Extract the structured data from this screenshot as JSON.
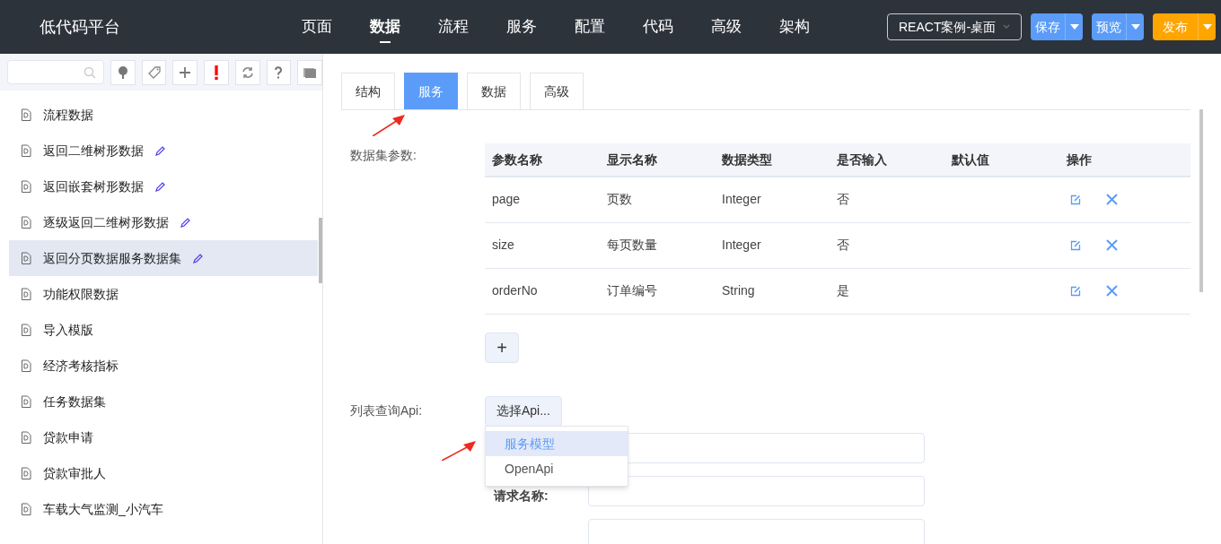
{
  "app_title": "低代码平台",
  "nav": [
    {
      "label": "页面",
      "selected": false
    },
    {
      "label": "数据",
      "selected": true
    },
    {
      "label": "流程",
      "selected": false
    },
    {
      "label": "服务",
      "selected": false
    },
    {
      "label": "配置",
      "selected": false
    },
    {
      "label": "代码",
      "selected": false
    },
    {
      "label": "高级",
      "selected": false
    },
    {
      "label": "架构",
      "selected": false
    }
  ],
  "project_select": {
    "value": "REACT案例-桌面"
  },
  "actions": [
    {
      "label": "保存",
      "kind": "blue"
    },
    {
      "label": "预览",
      "kind": "blue"
    },
    {
      "label": "发布",
      "kind": "orange"
    }
  ],
  "toolbar_icons": [
    {
      "kind": "tree"
    },
    {
      "kind": "tag"
    },
    {
      "kind": "plus"
    },
    {
      "kind": "alert"
    },
    {
      "kind": "refresh"
    },
    {
      "kind": "help"
    },
    {
      "kind": "layers"
    }
  ],
  "sidebar_items": [
    {
      "label": "流程数据",
      "selected": false,
      "editable": false
    },
    {
      "label": "返回二维树形数据",
      "selected": false,
      "editable": true
    },
    {
      "label": "返回嵌套树形数据",
      "selected": false,
      "editable": true
    },
    {
      "label": "逐级返回二维树形数据",
      "selected": false,
      "editable": true
    },
    {
      "label": "返回分页数据服务数据集",
      "selected": true,
      "editable": true
    },
    {
      "label": "功能权限数据",
      "selected": false,
      "editable": false
    },
    {
      "label": "导入模版",
      "selected": false,
      "editable": false
    },
    {
      "label": "经济考核指标",
      "selected": false,
      "editable": false
    },
    {
      "label": "任务数据集",
      "selected": false,
      "editable": false
    },
    {
      "label": "贷款申请",
      "selected": false,
      "editable": false
    },
    {
      "label": "贷款审批人",
      "selected": false,
      "editable": false
    },
    {
      "label": "车载大气监测_小汽车",
      "selected": false,
      "editable": false
    }
  ],
  "tabs": [
    {
      "label": "结构",
      "selected": false
    },
    {
      "label": "服务",
      "selected": true
    },
    {
      "label": "数据",
      "selected": false
    },
    {
      "label": "高级",
      "selected": false
    }
  ],
  "params_label": "数据集参数:",
  "table": {
    "columns": [
      "参数名称",
      "显示名称",
      "数据类型",
      "是否输入",
      "默认值",
      "操作"
    ],
    "rows": [
      [
        "page",
        "页数",
        "Integer",
        "否",
        ""
      ],
      [
        "size",
        "每页数量",
        "Integer",
        "否",
        ""
      ],
      [
        "orderNo",
        "订单编号",
        "String",
        "是",
        ""
      ]
    ]
  },
  "add_button": "+",
  "api_label": "列表查询Api:",
  "api_button": "选择Api...",
  "api_menu": [
    {
      "label": "服务模型",
      "selected": true
    },
    {
      "label": "OpenApi",
      "selected": false
    }
  ],
  "request_name_label": "请求名称:"
}
